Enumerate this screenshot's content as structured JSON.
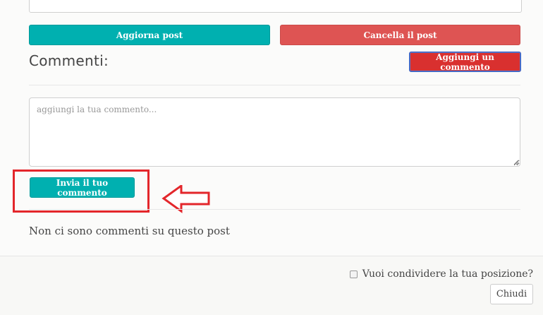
{
  "post_actions": {
    "update_label": "Aggiorna post",
    "delete_label": "Cancella il post"
  },
  "comments": {
    "title": "Commenti:",
    "add_label": "Aggiungi un commento",
    "input_placeholder": "aggiungi la tua commento...",
    "input_value": "",
    "send_label": "Invia il tuo commento",
    "empty_message": "Non ci sono commenti su questo post"
  },
  "footer": {
    "share_location_label": "Vuoi condividere la tua posizione?",
    "share_location_checked": false,
    "close_label": "Chiudi"
  },
  "annotations": {
    "highlight_color": "#e3262b",
    "arrow_direction": "left"
  },
  "colors": {
    "primary": "#00b0b0",
    "danger": "#de5453",
    "add_comment": "#d9302f"
  }
}
